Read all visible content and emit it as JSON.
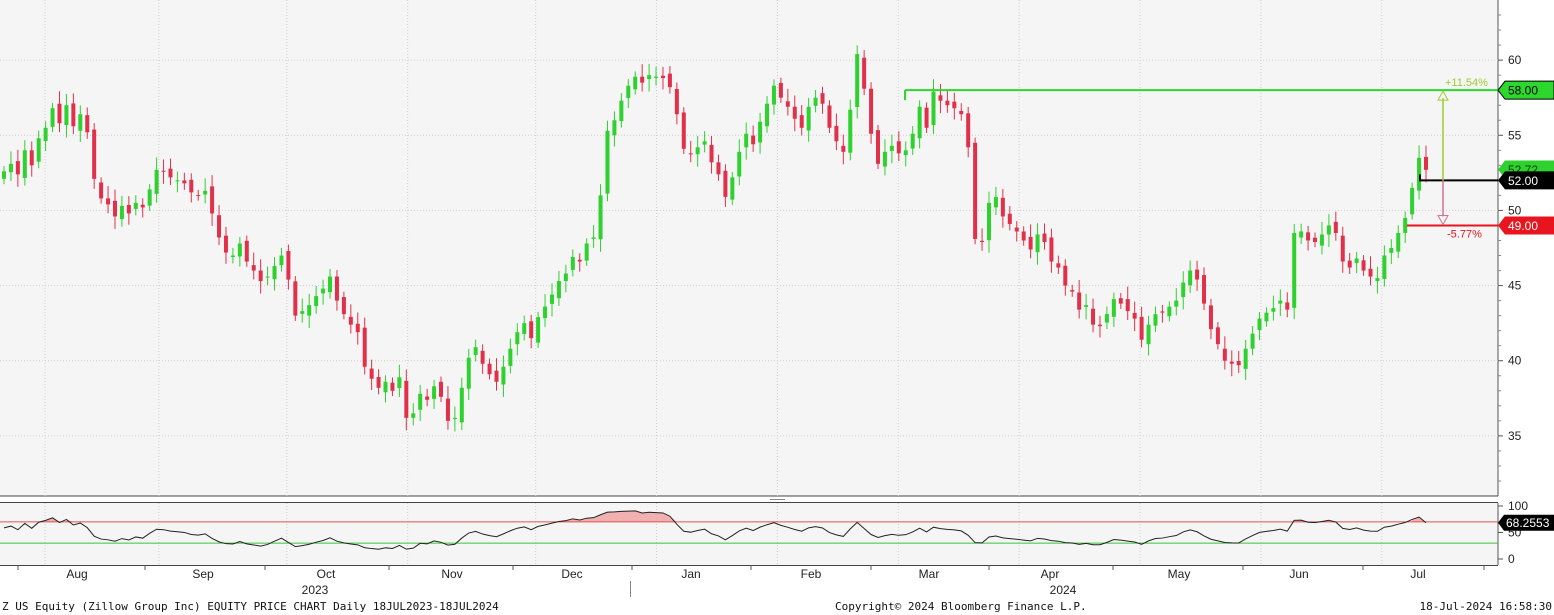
{
  "footer": {
    "left": "Z US Equity (Zillow Group Inc) EQUITY PRICE CHART  Daily 18JUL2023-18JUL2024",
    "center": "Copyright© 2024 Bloomberg Finance L.P.",
    "right": "18-Jul-2024 16:58:30"
  },
  "colors": {
    "up": "#2ed12e",
    "down": "#e0304a",
    "background": "#f5f5f5",
    "target_line": "#2bd82b",
    "stop_line": "#e8141e",
    "entry_line": "#000000"
  },
  "chart_data": [
    {
      "type": "candlestick",
      "ylim": [
        31,
        64
      ],
      "y_ticks": [
        35,
        40,
        45,
        50,
        55,
        60
      ],
      "x_month_labels": [
        "Aug",
        "Sep",
        "Oct",
        "Nov",
        "Dec",
        "Jan",
        "Feb",
        "Mar",
        "Apr",
        "May",
        "Jun",
        "Jul"
      ],
      "x_year_labels": [
        "2023",
        "2024"
      ],
      "closes": [
        52.6,
        53.1,
        52.4,
        54.0,
        53.0,
        54.8,
        55.5,
        56.8,
        55.8,
        57.0,
        55.6,
        56.4,
        55.2,
        52.1,
        50.8,
        50.4,
        49.6,
        50.3,
        49.8,
        50.5,
        50.2,
        51.4,
        52.7,
        52.6,
        52.2,
        52.0,
        51.8,
        51.2,
        51.0,
        51.3,
        49.8,
        48.2,
        47.2,
        47.0,
        47.8,
        46.6,
        46.0,
        45.3,
        45.6,
        46.3,
        47.0,
        45.4,
        43.0,
        43.3,
        43.7,
        44.3,
        44.8,
        45.6,
        44.0,
        43.1,
        42.4,
        41.9,
        39.6,
        38.8,
        38.2,
        38.6,
        38.0,
        38.9,
        36.2,
        36.5,
        37.8,
        37.4,
        38.3,
        37.6,
        36.0,
        36.2,
        38.2,
        40.2,
        40.9,
        39.8,
        39.1,
        38.6,
        39.6,
        40.8,
        41.9,
        42.5,
        41.5,
        42.9,
        43.6,
        44.4,
        45.3,
        45.8,
        46.9,
        46.6,
        47.8,
        48.2,
        51.0,
        55.3,
        56.0,
        57.3,
        58.3,
        58.9,
        58.5,
        59.0,
        58.9,
        58.8,
        58.2,
        56.4,
        54.1,
        53.8,
        54.2,
        54.6,
        53.2,
        52.4,
        50.9,
        52.2,
        53.9,
        55.1,
        54.4,
        55.9,
        57.1,
        58.3,
        57.5,
        56.9,
        56.1,
        55.5,
        56.9,
        57.5,
        57.1,
        55.5,
        54.6,
        53.9,
        56.7,
        60.4,
        58.1,
        55.1,
        53.1,
        53.9,
        54.3,
        53.8,
        54.0,
        55.1,
        56.9,
        55.5,
        57.9,
        57.3,
        57.0,
        56.8,
        56.4,
        54.2,
        48.1,
        47.9,
        50.5,
        50.9,
        49.6,
        49.1,
        48.6,
        48.0,
        47.4,
        48.4,
        47.9,
        46.6,
        46.2,
        45.0,
        44.6,
        43.4,
        43.7,
        42.4,
        42.3,
        43.1,
        44.1,
        43.8,
        43.3,
        42.8,
        41.4,
        42.4,
        43.1,
        43.2,
        43.6,
        44.0,
        45.2,
        46.0,
        45.4,
        43.8,
        42.1,
        41.1,
        40.0,
        39.8,
        39.7,
        40.8,
        41.8,
        42.8,
        43.2,
        43.5,
        44.0,
        43.4,
        48.5,
        48.6,
        48.0,
        47.9,
        48.4,
        49.0,
        48.5,
        46.6,
        46.2,
        46.8,
        46.0,
        45.6,
        45.5,
        47.0,
        47.5,
        48.5,
        49.5,
        51.5,
        53.5,
        52.7
      ],
      "entry": 52.0,
      "last_price": "52.72",
      "target": {
        "price": "58.00",
        "pct": "+11.54%"
      },
      "stop": {
        "price": "49.00",
        "pct": "-5.77%"
      }
    },
    {
      "type": "line",
      "series": "RSI",
      "ylim": [
        0,
        100
      ],
      "y_ticks": [
        0,
        50,
        100
      ],
      "overbought": 70,
      "oversold": 30,
      "last_value": "68.2553",
      "values": [
        58.7,
        62.1,
        55.3,
        67.3,
        57.9,
        69.4,
        72.9,
        77.7,
        68.8,
        74.6,
        64.2,
        67.8,
        59.2,
        43.1,
        37.6,
        36.2,
        33.5,
        38.5,
        35.9,
        41.6,
        39.3,
        48.4,
        56.2,
        55.3,
        52.7,
        51.4,
        50.1,
        46.3,
        45.0,
        47.4,
        38.8,
        32.3,
        28.9,
        28.3,
        33.0,
        28.5,
        26.5,
        24.4,
        27.5,
        33.6,
        39.3,
        31.2,
        23.3,
        25.3,
        27.9,
        31.7,
        34.9,
        40.0,
        33.6,
        30.5,
        28.2,
        26.7,
        21.3,
        19.7,
        18.5,
        21.1,
        19.8,
        25.6,
        18.6,
        20.5,
        29.6,
        28.5,
        34.2,
        31.5,
        26.2,
        27.8,
        39.5,
        49.0,
        52.0,
        47.1,
        44.1,
        42.0,
        47.4,
        53.3,
        58.1,
        60.5,
        55.2,
        61.5,
        64.4,
        67.6,
        70.7,
        72.4,
        75.8,
        73.7,
        77.0,
        78.0,
        83.5,
        88.4,
        88.9,
        89.8,
        90.4,
        90.8,
        86.9,
        88.1,
        87.5,
        86.9,
        80.7,
        65.4,
        52.3,
        50.6,
        53.8,
        56.3,
        47.6,
        43.5,
        36.3,
        44.3,
        53.0,
        58.2,
        53.7,
        60.1,
        64.7,
        68.6,
        63.5,
        59.8,
        55.6,
        52.4,
        58.8,
        61.1,
        58.5,
        49.9,
        45.6,
        42.6,
        56.8,
        69.1,
        57.5,
        46.2,
        40.6,
        44.1,
        46.4,
        44.7,
        45.9,
        51.1,
        58.2,
        51.0,
        60.0,
        57.4,
        56.0,
        55.0,
        53.0,
        44.7,
        30.8,
        30.5,
        41.5,
        43.3,
        39.8,
        38.5,
        37.2,
        35.7,
        34.3,
        39.0,
        37.7,
        34.6,
        33.6,
        30.9,
        30.2,
        27.6,
        29.5,
        27.0,
        26.9,
        31.4,
        36.8,
        35.6,
        33.8,
        32.1,
        27.6,
        34.2,
        38.6,
        39.5,
        42.1,
        44.3,
        51.1,
        55.0,
        51.4,
        43.6,
        37.3,
        34.2,
        31.1,
        30.5,
        30.3,
        37.8,
        44.3,
        50.2,
        52.2,
        53.7,
        56.3,
        52.6,
        73.0,
        73.4,
        69.3,
        68.6,
        70.8,
        73.2,
        69.6,
        57.7,
        55.6,
        58.6,
        54.5,
        52.6,
        52.3,
        59.9,
        62.0,
        65.7,
        68.8,
        74.6,
        79.2,
        68.3
      ]
    }
  ]
}
